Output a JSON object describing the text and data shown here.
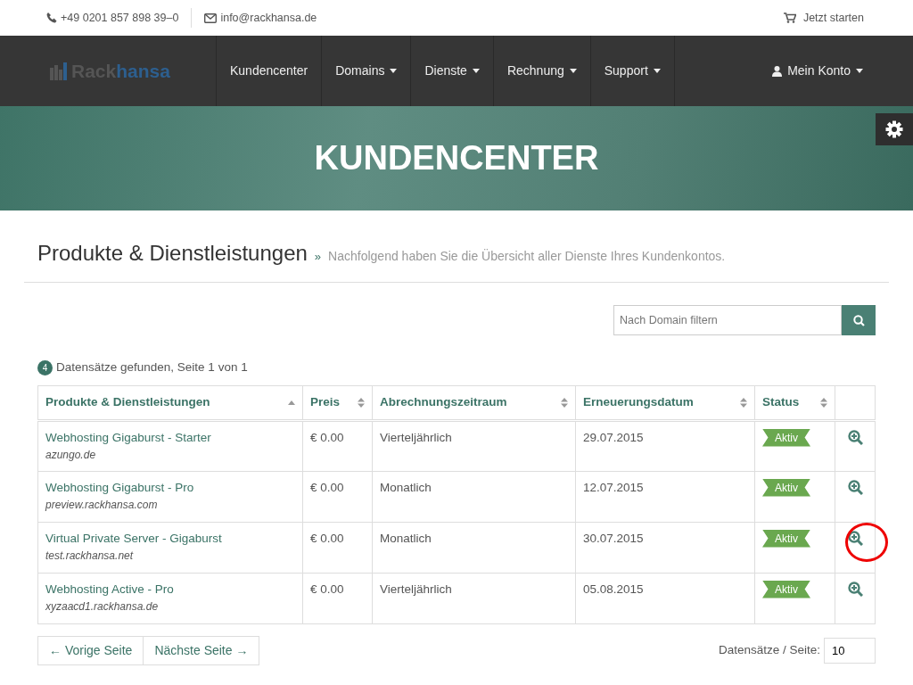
{
  "topbar": {
    "phone": "+49 0201 857 898 39–0",
    "email": "info@rackhansa.de",
    "cart": "Jetzt starten"
  },
  "navbar": {
    "logo_part_1": "Rack",
    "logo_part_2": "hansa",
    "items": [
      {
        "label": "Kundencenter",
        "dropdown": false
      },
      {
        "label": "Domains",
        "dropdown": true
      },
      {
        "label": "Dienste",
        "dropdown": true
      },
      {
        "label": "Rechnung",
        "dropdown": true
      },
      {
        "label": "Support",
        "dropdown": true
      }
    ],
    "account": {
      "label": "Mein Konto",
      "dropdown": true
    }
  },
  "banner": {
    "title": "KUNDENCENTER"
  },
  "page": {
    "title": "Produkte & Dienstleistungen",
    "separator": "»",
    "subtitle": "Nachfolgend haben Sie die Übersicht aller Dienste Ihres Kundenkontos."
  },
  "filter": {
    "placeholder": "Nach Domain filtern"
  },
  "summary": {
    "count": "4",
    "text": "Datensätze gefunden, Seite 1 von 1"
  },
  "table": {
    "columns": [
      {
        "label": "Produkte & Dienstleistungen",
        "sorted": true
      },
      {
        "label": "Preis",
        "sorted": false
      },
      {
        "label": "Abrechnungszeitraum",
        "sorted": false
      },
      {
        "label": "Erneuerungsdatum",
        "sorted": false
      },
      {
        "label": "Status",
        "sorted": false
      }
    ],
    "rows": [
      {
        "product": "Webhosting Gigaburst - Starter",
        "domain": "azungo.de",
        "price": "€ 0.00",
        "cycle": "Vierteljährlich",
        "date": "29.07.2015",
        "status": "Aktiv",
        "circled": false
      },
      {
        "product": "Webhosting Gigaburst - Pro",
        "domain": "preview.rackhansa.com",
        "price": "€ 0.00",
        "cycle": "Monatlich",
        "date": "12.07.2015",
        "status": "Aktiv",
        "circled": false
      },
      {
        "product": "Virtual Private Server - Gigaburst",
        "domain": "test.rackhansa.net",
        "price": "€ 0.00",
        "cycle": "Monatlich",
        "date": "30.07.2015",
        "status": "Aktiv",
        "circled": true
      },
      {
        "product": "Webhosting Active - Pro",
        "domain": "xyzaacd1.rackhansa.de",
        "price": "€ 0.00",
        "cycle": "Vierteljährlich",
        "date": "05.08.2015",
        "status": "Aktiv",
        "circled": false
      }
    ]
  },
  "pager": {
    "prev": "← Vorige Seite",
    "next": "Nächste Seite →",
    "per_page_label": "Datensätze / Seite:",
    "per_page": "10"
  }
}
